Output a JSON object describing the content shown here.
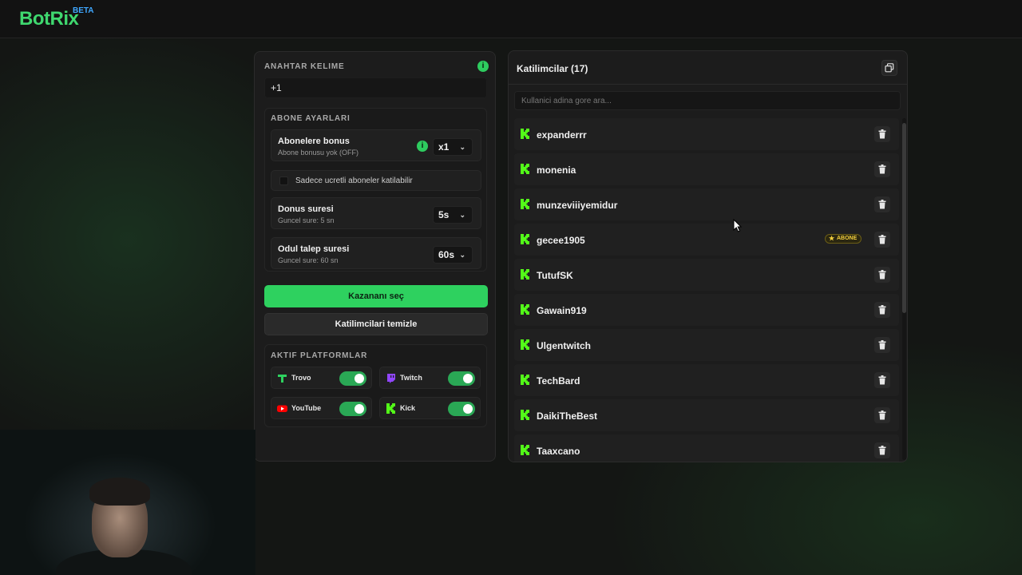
{
  "app": {
    "logo": "BotRix",
    "beta": "BETA"
  },
  "keyword": {
    "title": "ANAHTAR KELIME",
    "value": "+1",
    "info_glyph": "i"
  },
  "subscriber": {
    "title": "ABONE AYARLARI",
    "bonus": {
      "label": "Abonelere bonus",
      "sub": "Abone bonusu yok (OFF)",
      "value": "x1",
      "info_glyph": "i"
    },
    "paid_only": {
      "label": "Sadece ucretli aboneler katilabilir",
      "checked": false
    },
    "duration": {
      "label": "Donus suresi",
      "sub": "Guncel sure: 5 sn",
      "value": "5s"
    },
    "claim": {
      "label": "Odul talep suresi",
      "sub": "Guncel sure: 60 sn",
      "value": "60s"
    }
  },
  "actions": {
    "pick_winner": "Kazananı seç",
    "clear": "Katilimcilari temizle"
  },
  "platforms": {
    "title": "AKTIF PLATFORMLAR",
    "items": [
      {
        "name": "Trovo",
        "icon": "trovo-icon",
        "enabled": true
      },
      {
        "name": "Twitch",
        "icon": "twitch-icon",
        "enabled": true
      },
      {
        "name": "YouTube",
        "icon": "youtube-icon",
        "enabled": true
      },
      {
        "name": "Kick",
        "icon": "kick-icon",
        "enabled": true
      }
    ]
  },
  "participants": {
    "title": "Katilimcilar (17)",
    "search_placeholder": "Kullanici adina gore ara...",
    "items": [
      {
        "name": "expanderrr",
        "badge": ""
      },
      {
        "name": "monenia",
        "badge": ""
      },
      {
        "name": "munzeviiiyemidur",
        "badge": ""
      },
      {
        "name": "gecee1905",
        "badge": "ABONE"
      },
      {
        "name": "TutufSK",
        "badge": ""
      },
      {
        "name": "Gawain919",
        "badge": ""
      },
      {
        "name": "Ulgentwitch",
        "badge": ""
      },
      {
        "name": "TechBard",
        "badge": ""
      },
      {
        "name": "DaikiTheBest",
        "badge": ""
      },
      {
        "name": "Taaxcano",
        "badge": ""
      }
    ]
  },
  "colors": {
    "accent": "#2ed15f",
    "badge": "#f4d03f",
    "twitch": "#9146ff",
    "youtube": "#ff0000",
    "kick": "#53fc18"
  }
}
